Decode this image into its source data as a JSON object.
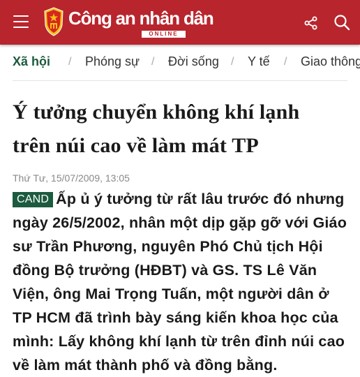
{
  "header": {
    "brand_name": "Công an nhân dân",
    "brand_tag": "ONLINE",
    "accent_color": "#b8252d"
  },
  "nav": {
    "items": [
      {
        "label": "Xã hội",
        "active": true
      },
      {
        "label": "Phóng sự",
        "active": false
      },
      {
        "label": "Đời sống",
        "active": false
      },
      {
        "label": "Y tế",
        "active": false
      },
      {
        "label": "Giao thông",
        "active": false
      }
    ],
    "separator": "/",
    "active_color": "#1c5b3d"
  },
  "article": {
    "title_line1": "Ý tưởng chuyển không khí lạnh",
    "title_line2": "trên núi cao về làm mát TP",
    "date": "Thứ Tư, 15/07/2009, 13:05",
    "source": "CAND",
    "body": "Ấp ủ ý tưởng từ rất lâu trước đó nhưng ngày 26/5/2002, nhân một dịp gặp gỡ với Giáo sư Trần Phương, nguyên Phó Chủ tịch Hội đồng Bộ trưởng (HĐBT) và GS. TS Lê Văn Viện, ông Mai Trọng Tuấn, một người dân ở TP HCM đã trình bày sáng kiến khoa học của mình: Lấy không khí lạnh từ trên đỉnh núi cao về làm mát thành phố và đồng bằng."
  },
  "icons": [
    "menu-icon",
    "emblem-icon",
    "share-icon",
    "search-icon"
  ]
}
